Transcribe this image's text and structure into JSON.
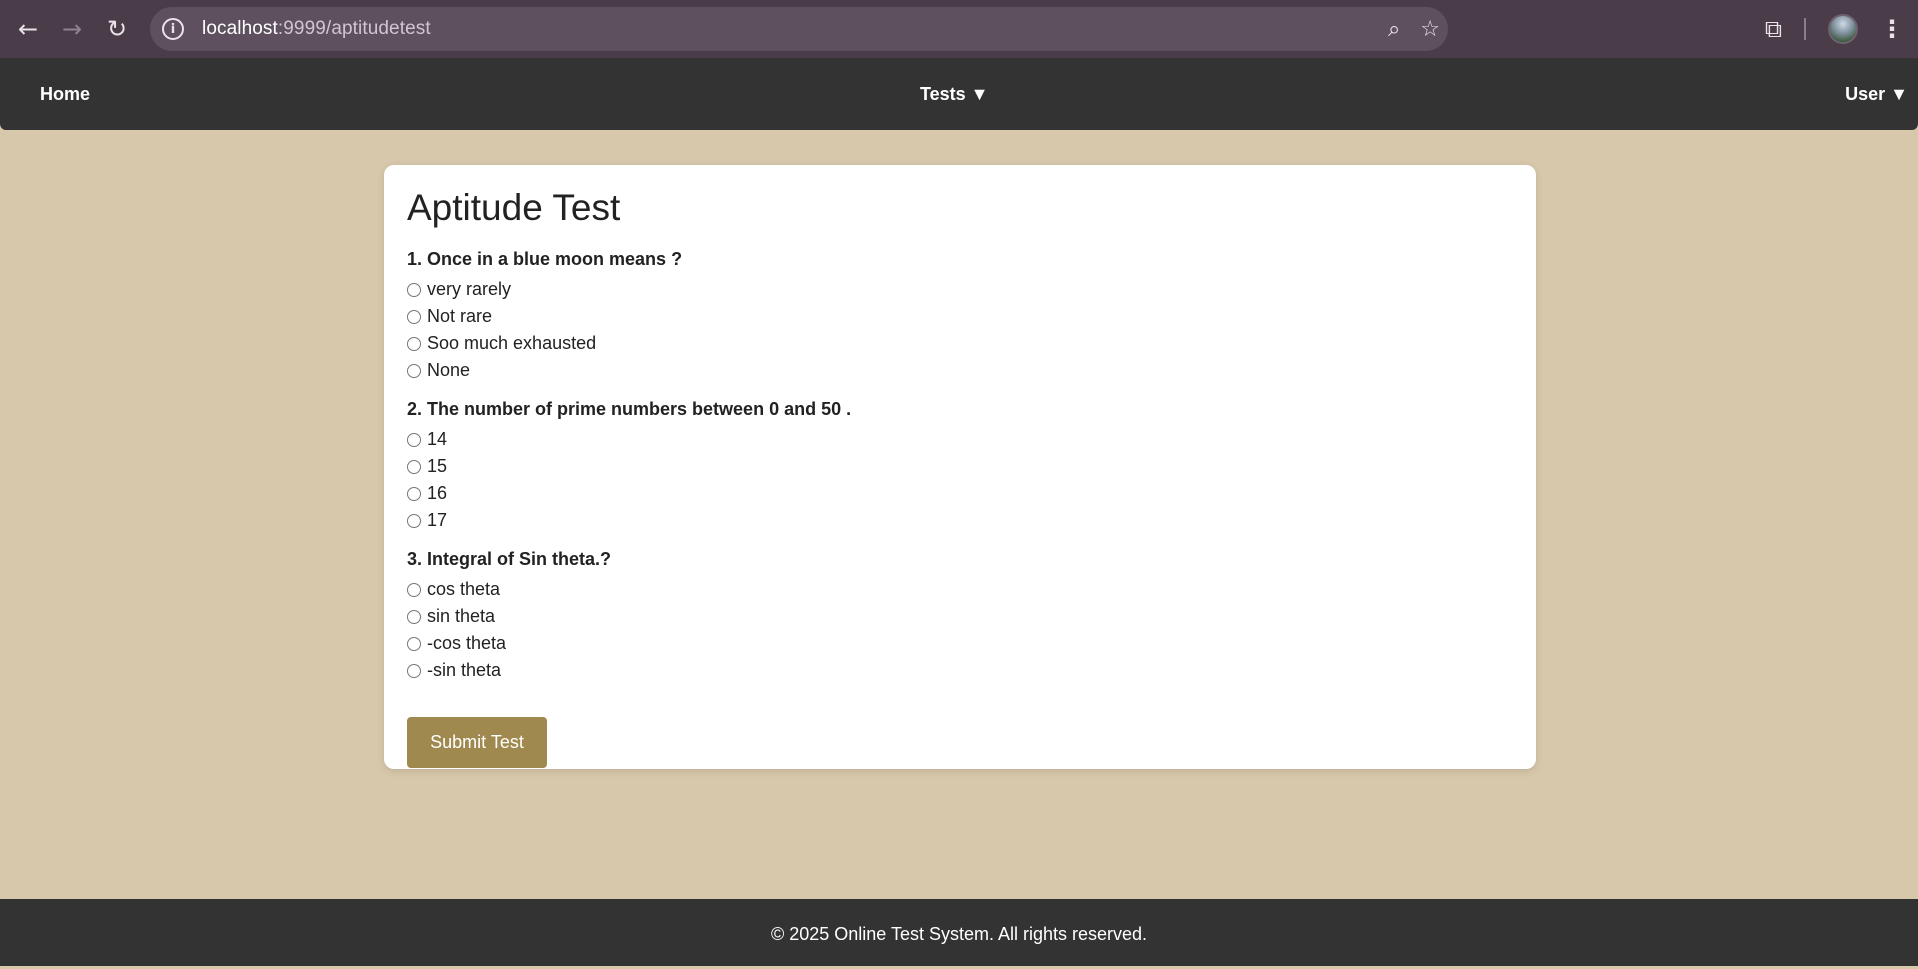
{
  "browser": {
    "url_host": "localhost",
    "url_path": ":9999/aptitudetest",
    "icons": {
      "back": "back-arrow-icon",
      "forward": "forward-arrow-icon",
      "reload": "reload-icon",
      "site_info": "info-icon",
      "zoom": "zoom-icon",
      "bookmark": "star-icon",
      "extensions": "puzzle-icon",
      "profile": "avatar",
      "menu": "kebab-menu-icon"
    }
  },
  "navbar": {
    "home": "Home",
    "tests": "Tests ▼",
    "user": "User ▼"
  },
  "test": {
    "title": "Aptitude Test",
    "questions": [
      {
        "label": "1. Once in a blue moon means ?",
        "options": [
          "very rarely",
          "Not rare",
          "Soo much exhausted",
          "None"
        ]
      },
      {
        "label": "2. The number of prime numbers between 0 and 50 .",
        "options": [
          "14",
          "15",
          "16",
          "17"
        ]
      },
      {
        "label": "3. Integral of Sin theta.?",
        "options": [
          "cos theta",
          "sin theta",
          "-cos theta",
          "-sin theta"
        ]
      }
    ],
    "submit_label": "Submit Test"
  },
  "footer": {
    "text": "© 2025 Online Test System. All rights reserved."
  },
  "colors": {
    "page_bg": "#d8c8ab",
    "navbar_bg": "#333333",
    "submit_bg": "#a0894f",
    "browser_bg": "#4a3c48"
  }
}
